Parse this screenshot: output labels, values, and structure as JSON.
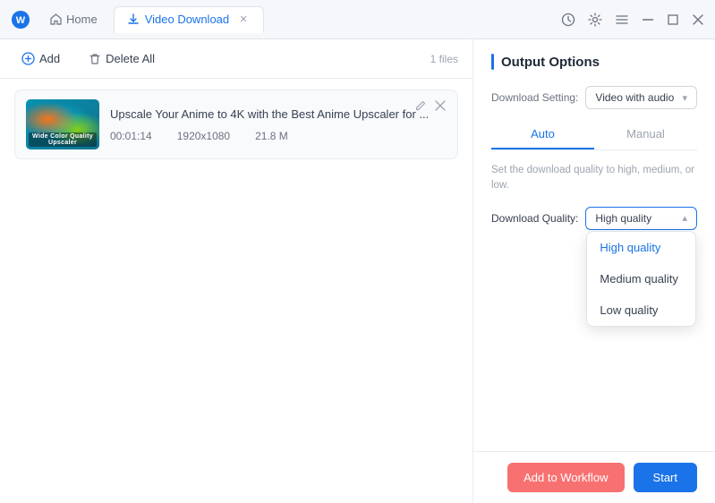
{
  "app": {
    "logo_char": "✦",
    "accent_color": "#1a73e8"
  },
  "titlebar": {
    "home_tab": "Home",
    "active_tab": "Video Download",
    "icons": {
      "history": "🕐",
      "settings": "⚙",
      "menu": "☰"
    },
    "win_controls": {
      "minimize": "—",
      "maximize": "□",
      "close": "✕"
    }
  },
  "toolbar": {
    "add_label": "Add",
    "delete_label": "Delete All",
    "file_count": "1 files"
  },
  "file_item": {
    "title": "Upscale Your Anime to 4K with the Best Anime Upscaler for ...",
    "duration": "00:01:14",
    "resolution": "1920x1080",
    "size": "21.8 M",
    "thumbnail_label": "Wide Color Quality Upscaler"
  },
  "right_panel": {
    "output_options_title": "Output Options",
    "download_setting_label": "Download Setting:",
    "download_setting_value": "Video with audio",
    "tabs": [
      {
        "id": "auto",
        "label": "Auto"
      },
      {
        "id": "manual",
        "label": "Manual"
      }
    ],
    "active_tab": "auto",
    "quality_description": "Set the download quality to high, medium, or low.",
    "quality_label": "Download Quality:",
    "quality_value": "High quality",
    "quality_options": [
      {
        "id": "high",
        "label": "High quality",
        "selected": true
      },
      {
        "id": "medium",
        "label": "Medium quality",
        "selected": false
      },
      {
        "id": "low",
        "label": "Low quality",
        "selected": false
      }
    ]
  },
  "buttons": {
    "workflow": "Add to Workflow",
    "start": "Start"
  }
}
